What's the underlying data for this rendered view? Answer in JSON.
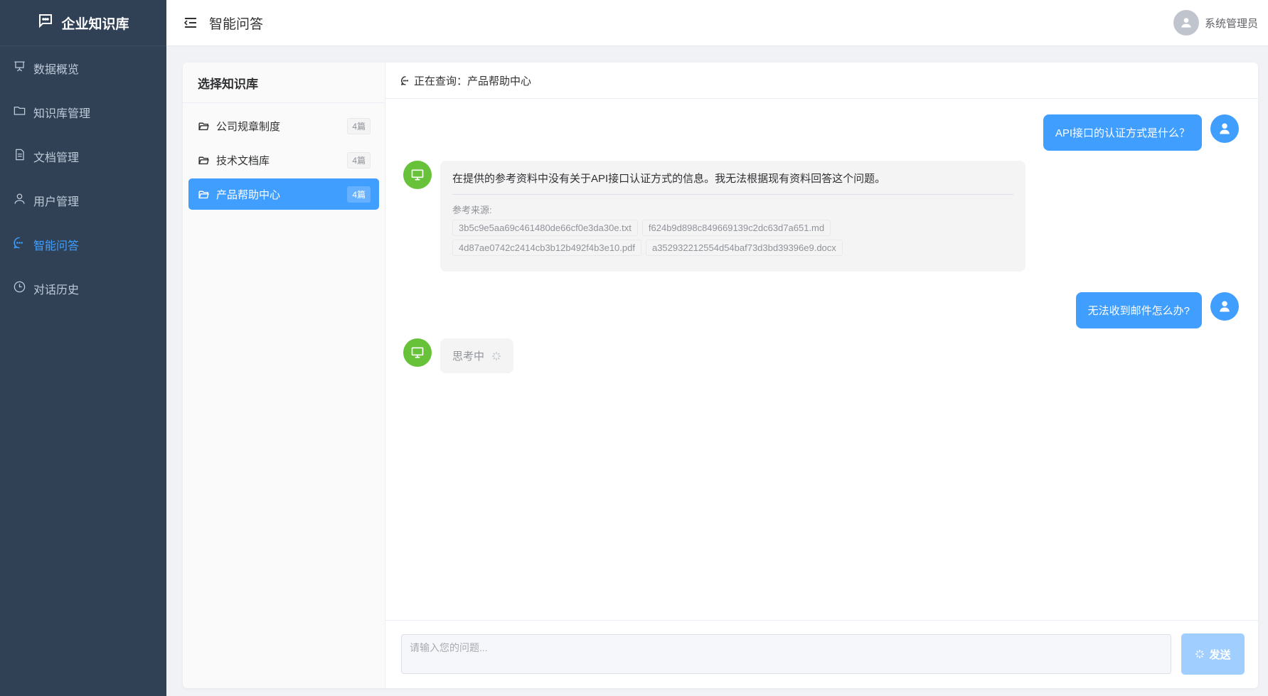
{
  "brand": {
    "title": "企业知识库",
    "icon": "chat-dots-icon"
  },
  "menu": [
    {
      "label": "数据概览",
      "icon": "presentation-icon",
      "active": false
    },
    {
      "label": "知识库管理",
      "icon": "folder-icon",
      "active": false
    },
    {
      "label": "文档管理",
      "icon": "document-icon",
      "active": false
    },
    {
      "label": "用户管理",
      "icon": "user-icon",
      "active": false
    },
    {
      "label": "智能问答",
      "icon": "chat-icon",
      "active": true
    },
    {
      "label": "对话历史",
      "icon": "clock-icon",
      "active": false
    }
  ],
  "header": {
    "title": "智能问答",
    "user_name": "系统管理员"
  },
  "kb_panel": {
    "title": "选择知识库",
    "items": [
      {
        "name": "公司规章制度",
        "count": "4篇",
        "active": false
      },
      {
        "name": "技术文档库",
        "count": "4篇",
        "active": false
      },
      {
        "name": "产品帮助中心",
        "count": "4篇",
        "active": true
      }
    ]
  },
  "chat": {
    "header_text": "正在查询：产品帮助中心",
    "messages": {
      "q1": "API接口的认证方式是什么？",
      "a1": "在提供的参考资料中没有关于API接口认证方式的信息。我无法根据现有资料回答这个问题。",
      "sources_label": "参考来源:",
      "sources": [
        "3b5c9e5aa69c461480de66cf0e3da30e.txt",
        "f624b9d898c849669139c2dc63d7a651.md",
        "4d87ae0742c2414cb3b12b492f4b3e10.pdf",
        "a352932212554d54baf73d3bd39396e9.docx"
      ],
      "q2": "无法收到邮件怎么办?",
      "thinking": "思考中"
    },
    "input": {
      "placeholder": "请输入您的问题...",
      "value": ""
    },
    "send_label": "发送"
  },
  "colors": {
    "sidebar_bg": "#304156",
    "primary": "#409eff",
    "bot": "#67c23a",
    "send_disabled": "#a0cfff"
  }
}
